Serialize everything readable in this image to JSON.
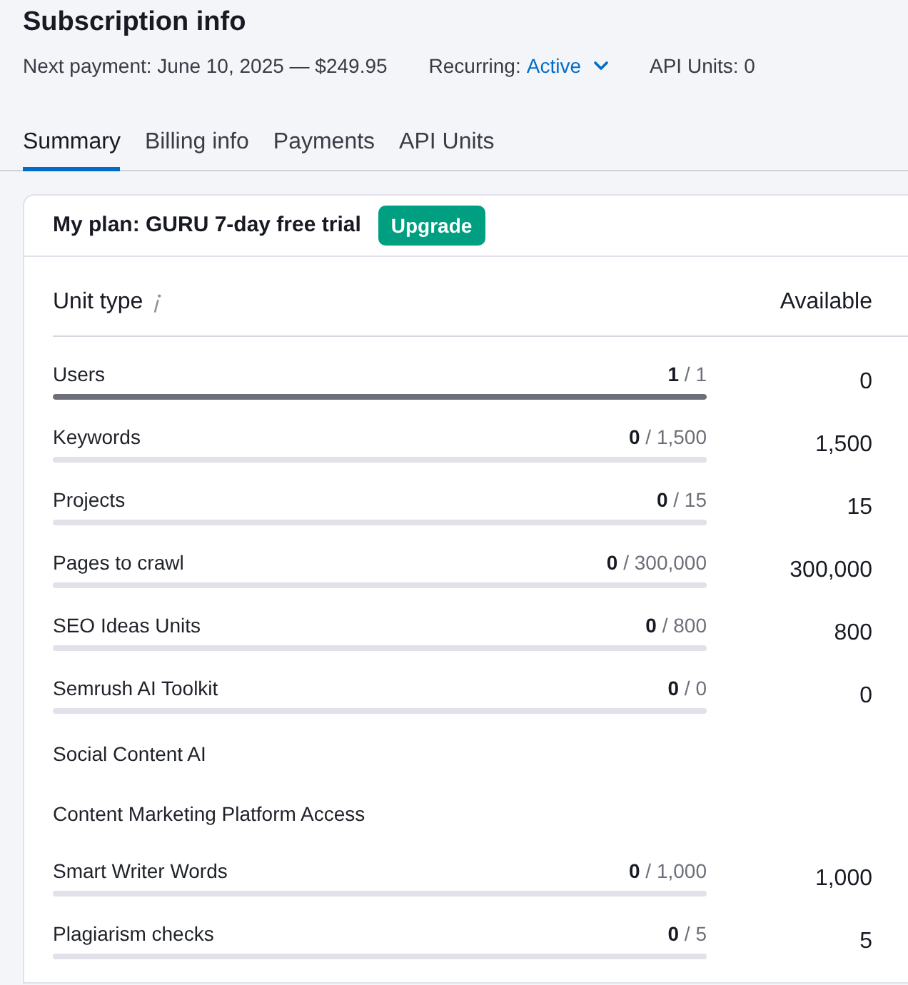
{
  "page": {
    "title": "Subscription info"
  },
  "summary": {
    "next_payment": "Next payment: June 10, 2025 — $249.95",
    "recurring": {
      "label": "Recurring:",
      "value": "Active"
    },
    "api_units": "API Units: 0"
  },
  "tabs": [
    {
      "label": "Summary",
      "selected": true
    },
    {
      "label": "Billing info",
      "selected": false
    },
    {
      "label": "Payments",
      "selected": false
    },
    {
      "label": "API Units",
      "selected": false
    }
  ],
  "plan": {
    "title": "My plan: GURU 7-day free trial",
    "upgrade_button": "Upgrade"
  },
  "table": {
    "columns": [
      "Unit type",
      "Available"
    ],
    "rows": [
      {
        "kind": "usage",
        "label": "Users",
        "count": "**1** / 1",
        "level": 1,
        "available": "0"
      },
      {
        "kind": "usage",
        "label": "Keywords",
        "count": "**0** / 1,500",
        "level": 0,
        "available": "1,500"
      },
      {
        "kind": "usage",
        "label": "Projects",
        "count": "**0** / 15",
        "level": 0,
        "available": "15"
      },
      {
        "kind": "usage",
        "label": "Pages to crawl",
        "count": "**0** / 300,000",
        "level": 0,
        "available": "300,000"
      },
      {
        "kind": "usage",
        "label": "SEO Ideas Units",
        "count": "**0** / 800",
        "level": 0,
        "available": "800"
      },
      {
        "kind": "usage",
        "label": "Semrush AI Toolkit",
        "count": "**0** / 0",
        "level": 0,
        "available": "0"
      },
      {
        "kind": "feature",
        "label": "Social Content AI"
      },
      {
        "kind": "feature",
        "label": "Content Marketing Platform Access"
      },
      {
        "kind": "usage",
        "label": "Smart Writer Words",
        "count": "**0** / 1,000",
        "level": 0,
        "available": "1,000"
      },
      {
        "kind": "usage",
        "label": "Plagiarism checks",
        "count": "**0** / 5",
        "level": 0,
        "available": "5"
      }
    ]
  }
}
